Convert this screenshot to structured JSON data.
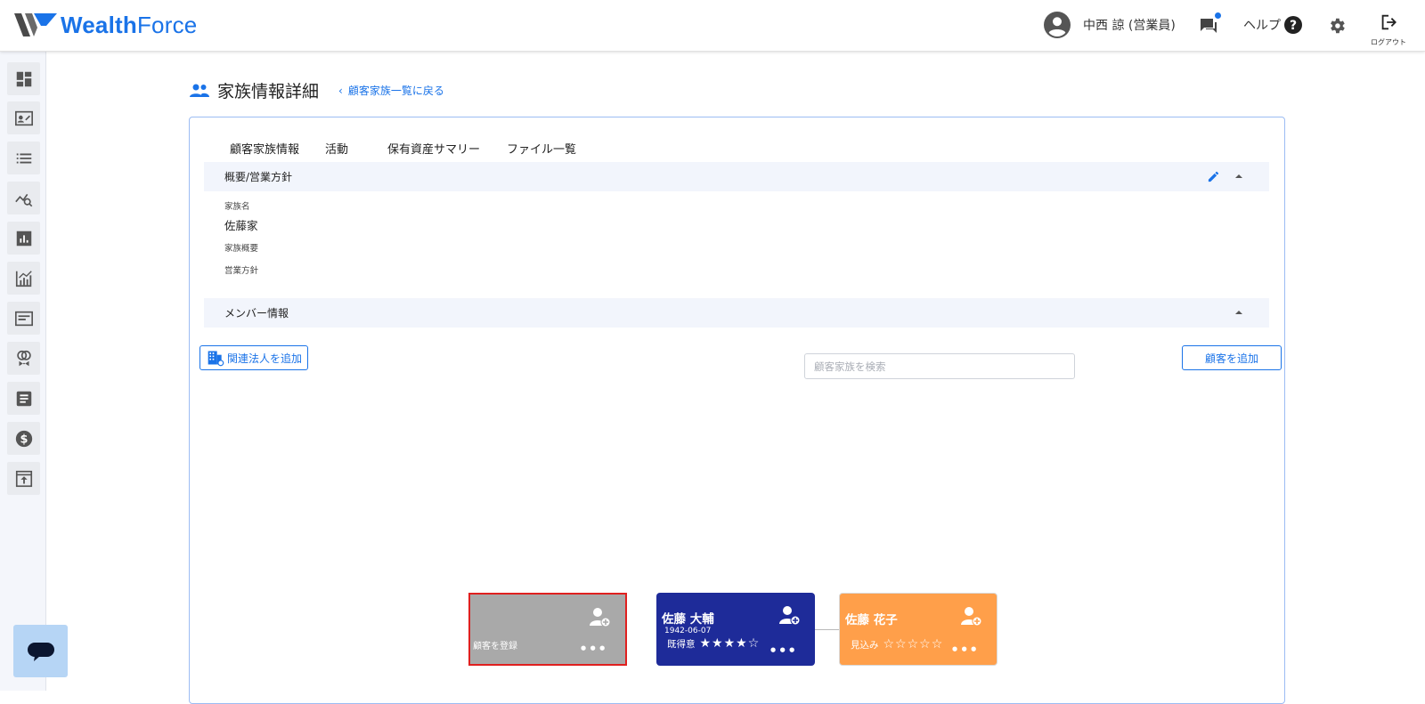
{
  "app": {
    "brand_first": "Wealth",
    "brand_second": "Force"
  },
  "header": {
    "user_name": "中西 諒 (営業員)",
    "help_label": "ヘルプ",
    "logout_label": "ログアウト"
  },
  "sidebar": {
    "items": [
      {
        "icon": "dashboard-icon"
      },
      {
        "icon": "contact-card-icon"
      },
      {
        "icon": "list-icon"
      },
      {
        "icon": "search-analytics-icon"
      },
      {
        "icon": "bar-chart-icon"
      },
      {
        "icon": "line-chart-icon"
      },
      {
        "icon": "news-icon"
      },
      {
        "icon": "tickets-icon"
      },
      {
        "icon": "document-icon"
      },
      {
        "icon": "dollar-icon"
      },
      {
        "icon": "upload-icon"
      }
    ]
  },
  "page": {
    "title": "家族情報詳細",
    "back_link": "顧客家族一覧に戻る"
  },
  "tabs": [
    {
      "label": "顧客家族情報",
      "active": true
    },
    {
      "label": "活動",
      "active": false
    },
    {
      "label": "保有資産サマリー",
      "active": false
    },
    {
      "label": "ファイル一覧",
      "active": false
    }
  ],
  "overview": {
    "section_title": "概要/営業方針",
    "family_name_label": "家族名",
    "family_name_value": "佐藤家",
    "family_summary_label": "家族概要",
    "sales_policy_label": "営業方針"
  },
  "members": {
    "section_title": "メンバー情報",
    "add_corporation_button": "関連法人を追加",
    "search_placeholder": "顧客家族を検索",
    "add_customer_button": "顧客を追加"
  },
  "family_tree": {
    "placeholder_card_label": "顧客を登録",
    "cards": [
      {
        "name": "佐藤 大輔",
        "dob": "1942-06-07",
        "status": "既得意",
        "stars": "★★★★☆",
        "rating": 4
      },
      {
        "name": "佐藤 花子",
        "status": "見込み",
        "stars": "☆☆☆☆☆",
        "rating": 0
      }
    ],
    "more_label": "•••"
  },
  "colors": {
    "accent": "#1a73e8",
    "card_blue": "#1e2b99",
    "card_orange": "#ff9f4a",
    "card_gray": "#a9a9a9"
  }
}
